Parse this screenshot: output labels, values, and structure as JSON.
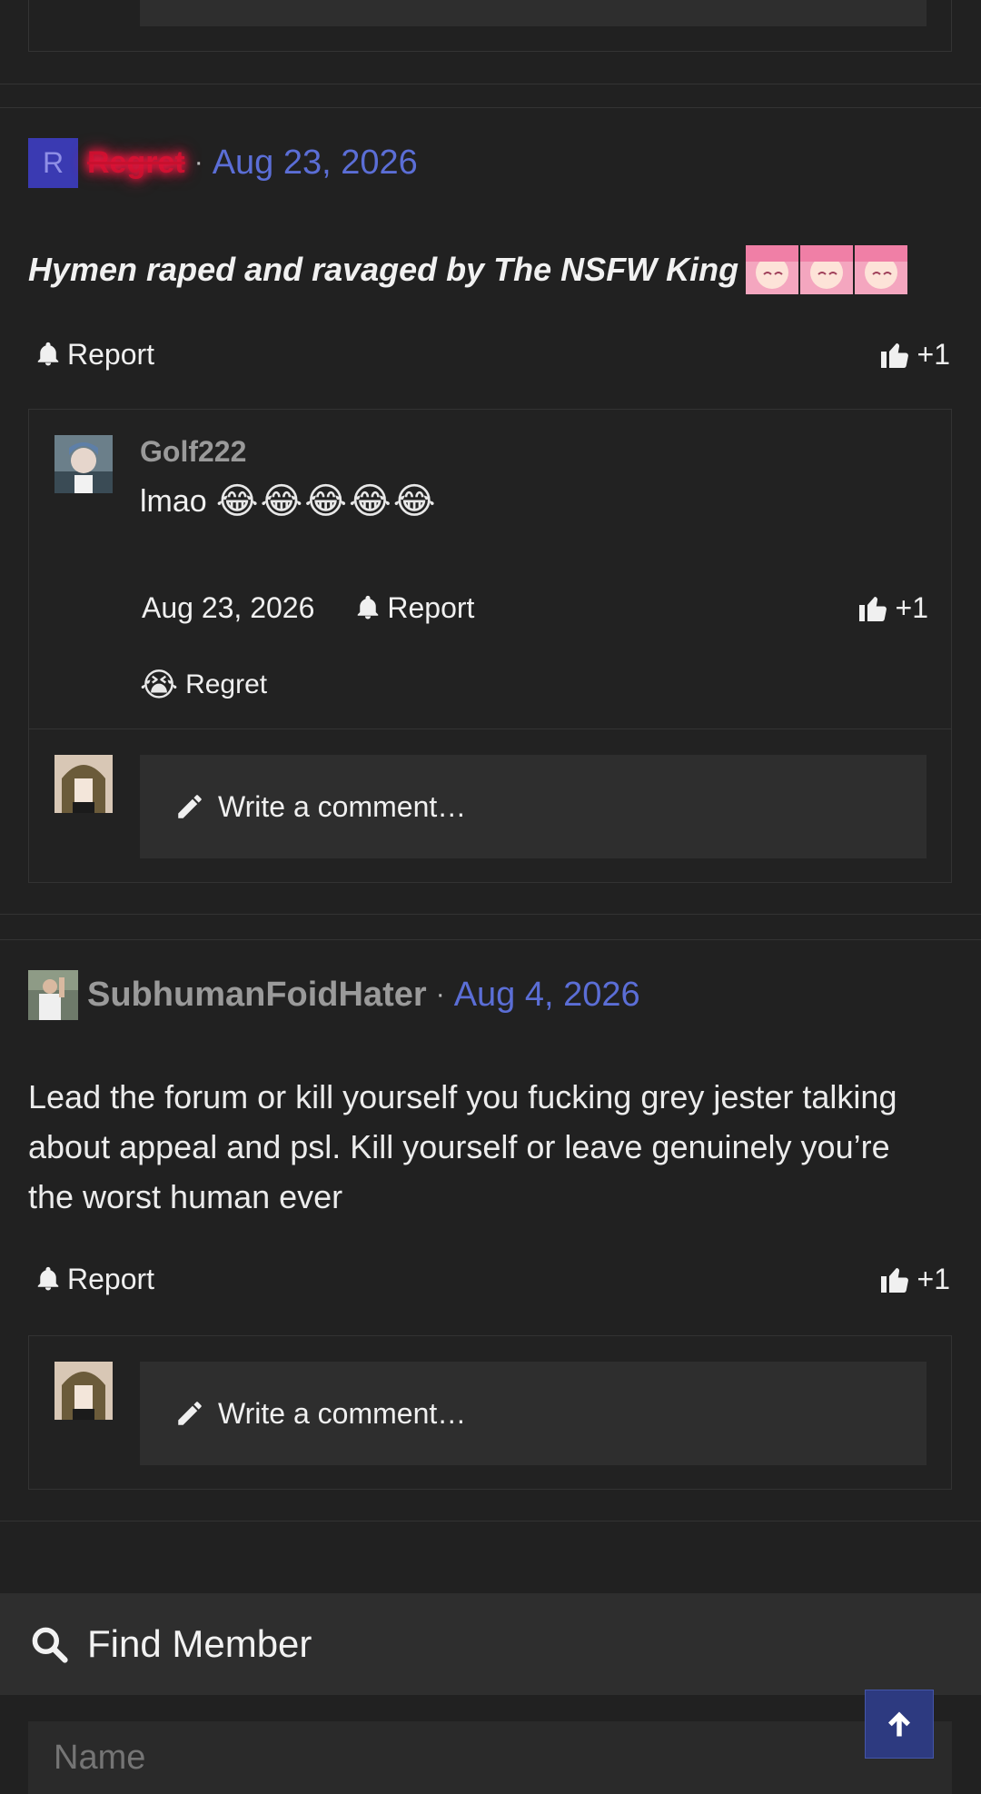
{
  "post1": {
    "avatar_letter": "R",
    "username": "Regret",
    "separator": "·",
    "date": "Aug 23, 2026",
    "body": "Hymen raped and ravaged by The NSFW King",
    "report_label": "Report",
    "reaction_count": "+1"
  },
  "comment1": {
    "username": "Golf222",
    "text": "lmao",
    "emoji_count": 5,
    "date": "Aug 23, 2026",
    "report_label": "Report",
    "reaction_count": "+1",
    "reacted_by": "Regret",
    "reaction_emoji": "😭"
  },
  "post1_write": {
    "placeholder": "Write a comment…"
  },
  "post2": {
    "username": "SubhumanFoidHater",
    "separator": "·",
    "date": "Aug 4, 2026",
    "body": "Lead the forum or kill yourself you fucking grey jester talking about appeal and psl. Kill yourself or leave genuinely you’re the worst human ever",
    "report_label": "Report",
    "reaction_count": "+1"
  },
  "post2_write": {
    "placeholder": "Write a comment…"
  },
  "find_member": {
    "title": "Find Member",
    "name_placeholder": "Name"
  },
  "colors": {
    "background": "#212121",
    "panel": "#2e2e2e",
    "link_blue": "#5b6ed6",
    "regret_red": "#c8102e",
    "scroll_button": "#2d3a80"
  }
}
